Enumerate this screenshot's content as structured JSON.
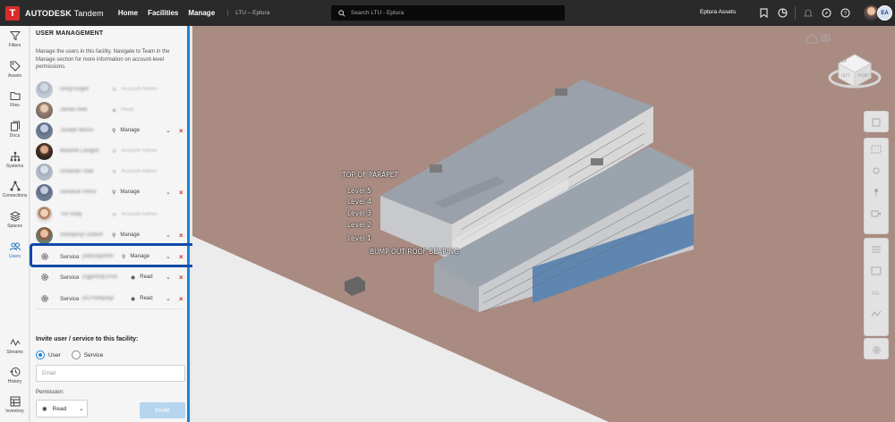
{
  "app": {
    "logo_letter": "T",
    "brand_bold": "AUTODESK",
    "brand_product": "Tandem",
    "nav": [
      "Home",
      "Facilities",
      "Manage"
    ],
    "facility": "LTU – Eptura",
    "search_placeholder": "Search LTU - Eptura",
    "assets_label": "Eptura Assets",
    "user_initials": "EA"
  },
  "rail": [
    {
      "label": "Filters",
      "icon": "filter-icon"
    },
    {
      "label": "Assets",
      "icon": "tag-icon"
    },
    {
      "label": "Files",
      "icon": "folder-icon"
    },
    {
      "label": "Docs",
      "icon": "document-icon"
    },
    {
      "label": "Systems",
      "icon": "systems-icon"
    },
    {
      "label": "Connections",
      "icon": "connections-icon"
    },
    {
      "label": "Spaces",
      "icon": "layers-icon"
    },
    {
      "label": "Users",
      "icon": "users-icon"
    },
    {
      "label": "Streams",
      "icon": "streams-icon"
    },
    {
      "label": "History",
      "icon": "history-icon"
    },
    {
      "label": "Inventory",
      "icon": "inventory-icon"
    }
  ],
  "panel": {
    "title": "USER MANAGEMENT",
    "description": "Manage the users in this facility. Navigate to Team in the Manage section for more information on account-level permissions.",
    "users": [
      {
        "name": "Greg Knight",
        "role": "Account Admin",
        "faded": true
      },
      {
        "name": "James Awe",
        "role": "Read",
        "faded": true
      },
      {
        "name": "Joseph Morris",
        "role": "Manage",
        "faded": false
      },
      {
        "name": "Maxime Lavigne",
        "role": "Account Admin",
        "faded": true
      },
      {
        "name": "Octavian Vlad",
        "role": "Account Admin",
        "faded": true
      },
      {
        "name": "Sonakse Petris",
        "role": "Manage",
        "faded": false
      },
      {
        "name": "Tim Kelly",
        "role": "Account Admin",
        "faded": true
      },
      {
        "name": "Volodymyr Dobrohan",
        "role": "Manage",
        "faded": false
      }
    ],
    "services": [
      {
        "label": "Service",
        "id": "(obk5sqo9rhl",
        "role": "Manage"
      },
      {
        "label": "Service",
        "id": "(1gpnfsqCPs5l",
        "role": "Read"
      },
      {
        "label": "Service",
        "id": "(41Yhdfqs6yt",
        "role": "Read"
      }
    ],
    "invite": {
      "title": "Invite user / service to this facility:",
      "options": [
        "User",
        "Service"
      ],
      "selected": "User",
      "email_placeholder": "Email",
      "permission_label": "Permission:",
      "permission_value": "Read",
      "button": "Invite"
    }
  },
  "viewer": {
    "labels": [
      "TOP OF PARAPET",
      "Level 5",
      "Level 4",
      "Level 3",
      "Level 2",
      "Level 1",
      "BUMP OUT ROOF BEARING"
    ],
    "viewcube": {
      "top": "TOP",
      "left": "LEFT",
      "front": "FRONT"
    }
  }
}
